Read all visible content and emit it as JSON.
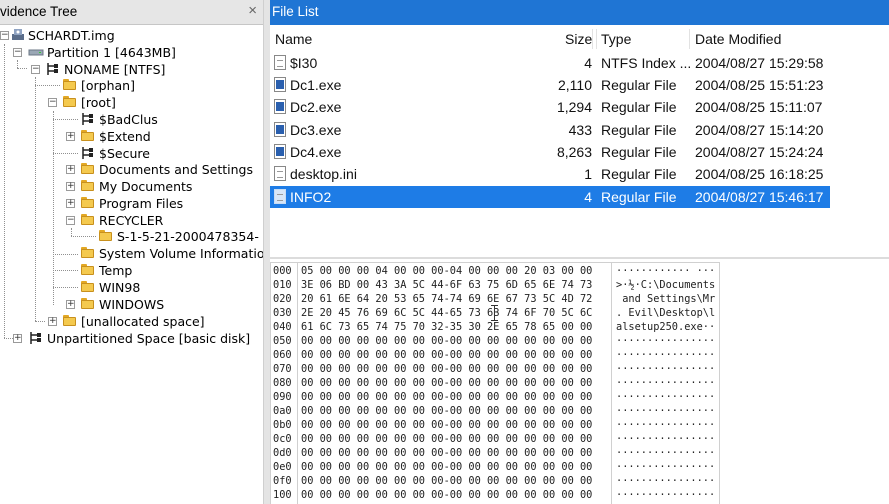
{
  "evidence_tree": {
    "title": "vidence Tree",
    "close_glyph": "×",
    "nodes": [
      {
        "label": "SCHARDT.img",
        "expanded": true
      },
      {
        "label": "Partition 1 [4643MB]",
        "expanded": true
      },
      {
        "label": "NONAME [NTFS]",
        "expanded": true
      },
      {
        "label": "[orphan]"
      },
      {
        "label": "[root]",
        "expanded": true
      },
      {
        "label": "$BadClus"
      },
      {
        "label": "$Extend",
        "expanded": false
      },
      {
        "label": "$Secure"
      },
      {
        "label": "Documents and Settings",
        "expanded": false
      },
      {
        "label": "My Documents",
        "expanded": false
      },
      {
        "label": "Program Files",
        "expanded": false
      },
      {
        "label": "RECYCLER",
        "expanded": true
      },
      {
        "label": "S-1-5-21-2000478354-"
      },
      {
        "label": "System Volume Information"
      },
      {
        "label": "Temp"
      },
      {
        "label": "WIN98"
      },
      {
        "label": "WINDOWS",
        "expanded": false
      },
      {
        "label": "[unallocated space]",
        "expanded": false
      },
      {
        "label": "Unpartitioned Space [basic disk]",
        "expanded": false
      }
    ]
  },
  "file_list": {
    "title": "File List",
    "columns": {
      "name": "Name",
      "size": "Size",
      "type": "Type",
      "modified": "Date Modified"
    },
    "rows": [
      {
        "name": "$I30",
        "size": "4",
        "type": "NTFS Index ...",
        "modified": "2004/08/27 15:29:58",
        "icon": "document-icon"
      },
      {
        "name": "Dc1.exe",
        "size": "2,110",
        "type": "Regular File",
        "modified": "2004/08/25 15:51:23",
        "icon": "executable-icon"
      },
      {
        "name": "Dc2.exe",
        "size": "1,294",
        "type": "Regular File",
        "modified": "2004/08/25 15:11:07",
        "icon": "executable-icon"
      },
      {
        "name": "Dc3.exe",
        "size": "433",
        "type": "Regular File",
        "modified": "2004/08/27 15:14:20",
        "icon": "executable-icon"
      },
      {
        "name": "Dc4.exe",
        "size": "8,263",
        "type": "Regular File",
        "modified": "2004/08/27 15:24:24",
        "icon": "executable-icon"
      },
      {
        "name": "desktop.ini",
        "size": "1",
        "type": "Regular File",
        "modified": "2004/08/25 16:18:25",
        "icon": "document-icon"
      },
      {
        "name": "INFO2",
        "size": "4",
        "type": "Regular File",
        "modified": "2004/08/27 15:46:17",
        "icon": "document-icon",
        "selected": true
      }
    ]
  },
  "hex_view": {
    "rows": [
      {
        "offset": "000",
        "bytes": "05 00 00 00 04 00 00 00-04 00 00 00 20 03 00 00",
        "ascii": "············ ···"
      },
      {
        "offset": "010",
        "bytes": "3E 06 BD 00 43 3A 5C 44-6F 63 75 6D 65 6E 74 73",
        "ascii": ">·½·C:\\Documents"
      },
      {
        "offset": "020",
        "bytes": "20 61 6E 64 20 53 65 74-74 69 6E 67 73 5C 4D 72",
        "ascii": " and Settings\\Mr"
      },
      {
        "offset": "030",
        "bytes": "2E 20 45 76 69 6C 5C 44-65 73 6B 74 6F 70 5C 6C",
        "ascii": ". Evil\\Desktop\\l"
      },
      {
        "offset": "040",
        "bytes": "61 6C 73 65 74 75 70 32-35 30 2E 65 78 65 00 00",
        "ascii": "alsetup250.exe··"
      },
      {
        "offset": "050",
        "bytes": "00 00 00 00 00 00 00 00-00 00 00 00 00 00 00 00",
        "ascii": "················"
      },
      {
        "offset": "060",
        "bytes": "00 00 00 00 00 00 00 00-00 00 00 00 00 00 00 00",
        "ascii": "················"
      },
      {
        "offset": "070",
        "bytes": "00 00 00 00 00 00 00 00-00 00 00 00 00 00 00 00",
        "ascii": "················"
      },
      {
        "offset": "080",
        "bytes": "00 00 00 00 00 00 00 00-00 00 00 00 00 00 00 00",
        "ascii": "················"
      },
      {
        "offset": "090",
        "bytes": "00 00 00 00 00 00 00 00-00 00 00 00 00 00 00 00",
        "ascii": "················"
      },
      {
        "offset": "0a0",
        "bytes": "00 00 00 00 00 00 00 00-00 00 00 00 00 00 00 00",
        "ascii": "················"
      },
      {
        "offset": "0b0",
        "bytes": "00 00 00 00 00 00 00 00-00 00 00 00 00 00 00 00",
        "ascii": "················"
      },
      {
        "offset": "0c0",
        "bytes": "00 00 00 00 00 00 00 00-00 00 00 00 00 00 00 00",
        "ascii": "················"
      },
      {
        "offset": "0d0",
        "bytes": "00 00 00 00 00 00 00 00-00 00 00 00 00 00 00 00",
        "ascii": "················"
      },
      {
        "offset": "0e0",
        "bytes": "00 00 00 00 00 00 00 00-00 00 00 00 00 00 00 00",
        "ascii": "················"
      },
      {
        "offset": "0f0",
        "bytes": "00 00 00 00 00 00 00 00-00 00 00 00 00 00 00 00",
        "ascii": "················"
      },
      {
        "offset": "100",
        "bytes": "00 00 00 00 00 00 00 00-00 00 00 00 00 00 00 00",
        "ascii": "················"
      }
    ]
  },
  "colors": {
    "title_bar": "#1f75d4",
    "selection": "#1e7ce6",
    "folder": "#f4c94e"
  }
}
